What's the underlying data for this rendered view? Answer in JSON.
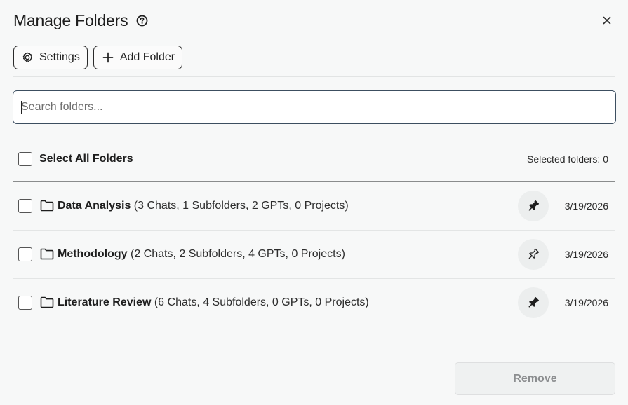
{
  "header": {
    "title": "Manage Folders",
    "close_symbol": "×"
  },
  "toolbar": {
    "settings_label": "Settings",
    "add_folder_label": "Add Folder"
  },
  "search": {
    "placeholder": "Search folders...",
    "value": ""
  },
  "selection": {
    "select_all_label": "Select All Folders",
    "selected_count_text": "Selected folders: 0"
  },
  "folders": [
    {
      "name": "Data Analysis",
      "details": "(3 Chats, 1 Subfolders, 2 GPTs, 0 Projects)",
      "pinned": true,
      "date": "3/19/2026"
    },
    {
      "name": "Methodology",
      "details": "(2 Chats, 2 Subfolders, 4 GPTs, 0 Projects)",
      "pinned": false,
      "date": "3/19/2026"
    },
    {
      "name": "Literature Review",
      "details": "(6 Chats, 4 Subfolders, 0 GPTs, 0 Projects)",
      "pinned": true,
      "date": "3/19/2026"
    }
  ],
  "footer": {
    "remove_label": "Remove"
  },
  "icons": {
    "help": "help-circle-icon",
    "close": "close-icon",
    "settings": "gear-icon",
    "add": "plus-icon",
    "folder": "folder-icon",
    "pin_filled": "pin-filled-icon",
    "pin_outline": "pin-outline-icon"
  }
}
